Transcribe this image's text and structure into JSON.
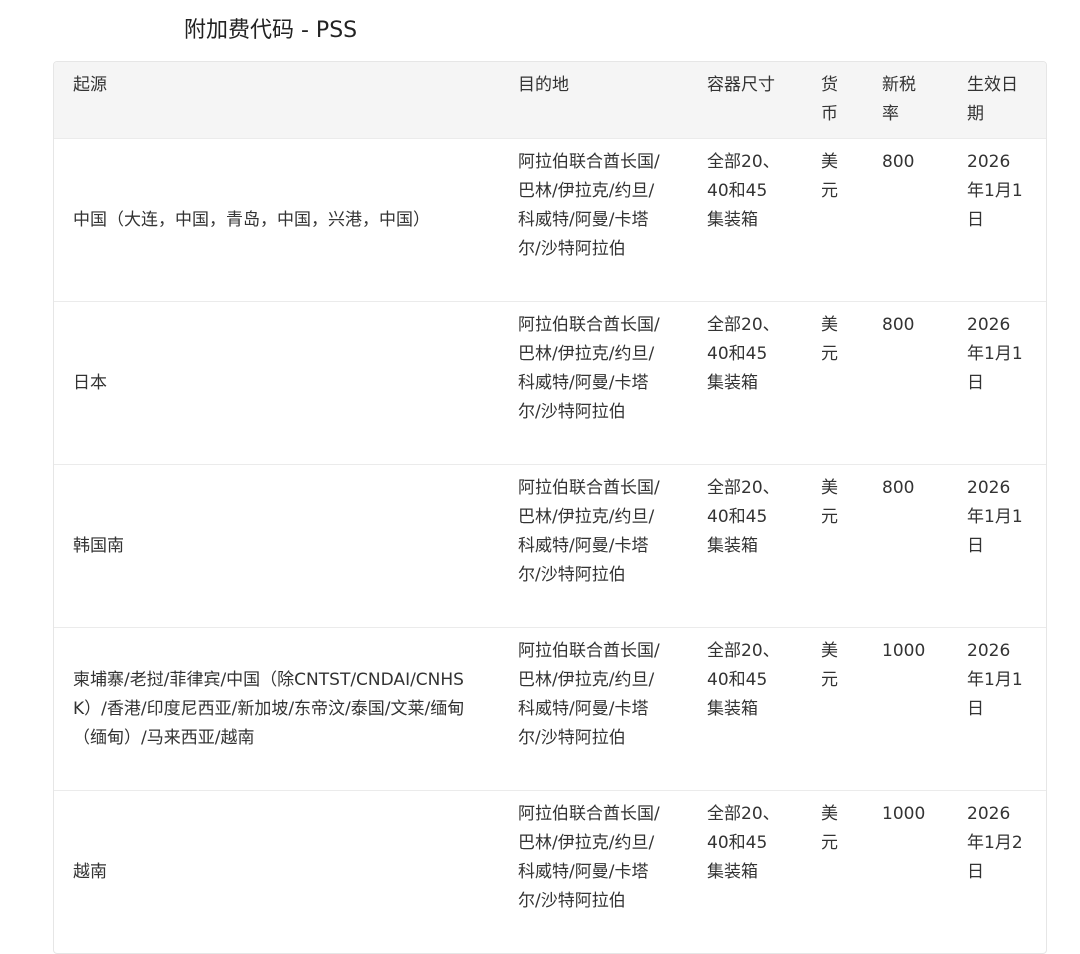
{
  "title": "附加费代码 - PSS",
  "headers": {
    "origin": "起源",
    "destination": "目的地",
    "container": "容器尺寸",
    "currency": "货币",
    "rate": "新税率",
    "effective": "生效日期"
  },
  "rows": [
    {
      "origin": "中国（大连，中国，青岛，中国，兴港，中国）",
      "destination": "阿拉伯联合酋长国/巴林/伊拉克/约旦/科威特/阿曼/卡塔尔/沙特阿拉伯",
      "container": "全部20、40和45集装箱",
      "currency": "美元",
      "rate": "800",
      "effective": "2026年1月1日"
    },
    {
      "origin": "日本",
      "destination": "阿拉伯联合酋长国/巴林/伊拉克/约旦/科威特/阿曼/卡塔尔/沙特阿拉伯",
      "container": "全部20、40和45集装箱",
      "currency": "美元",
      "rate": "800",
      "effective": "2026年1月1日"
    },
    {
      "origin": "韩国南",
      "destination": "阿拉伯联合酋长国/巴林/伊拉克/约旦/科威特/阿曼/卡塔尔/沙特阿拉伯",
      "container": "全部20、40和45集装箱",
      "currency": "美元",
      "rate": "800",
      "effective": "2026年1月1日"
    },
    {
      "origin": "柬埔寨/老挝/菲律宾/中国（除CNTST/CNDAI/CNHSK）/香港/印度尼西亚/新加坡/东帝汶/泰国/文莱/缅甸（缅甸）/马来西亚/越南",
      "destination": "阿拉伯联合酋长国/巴林/伊拉克/约旦/科威特/阿曼/卡塔尔/沙特阿拉伯",
      "container": "全部20、40和45集装箱",
      "currency": "美元",
      "rate": "1000",
      "effective": "2026年1月1日"
    },
    {
      "origin": "越南",
      "destination": "阿拉伯联合酋长国/巴林/伊拉克/约旦/科威特/阿曼/卡塔尔/沙特阿拉伯",
      "container": "全部20、40和45集装箱",
      "currency": "美元",
      "rate": "1000",
      "effective": "2026年1月2日"
    }
  ]
}
